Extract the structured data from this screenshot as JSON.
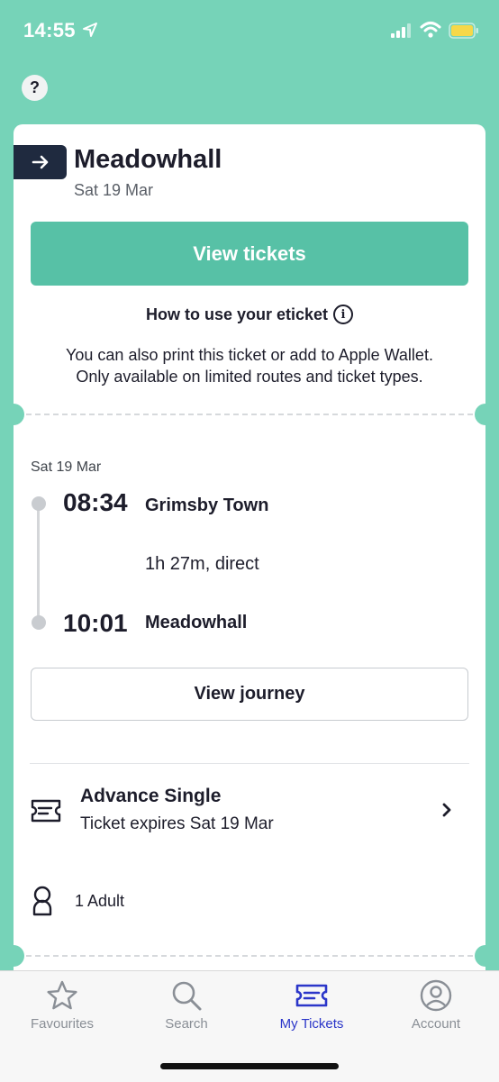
{
  "status_bar": {
    "time": "14:55"
  },
  "help_label": "?",
  "journey": {
    "destination": "Meadowhall",
    "date": "Sat 19 Mar",
    "view_tickets_label": "View tickets",
    "how_to_label": "How to use your eticket",
    "print_info_line1": "You can also print this ticket or add to Apple Wallet.",
    "print_info_line2": "Only available on limited routes and ticket types.",
    "leg_date": "Sat 19 Mar",
    "departure": {
      "time": "08:34",
      "station": "Grimsby Town"
    },
    "duration": "1h 27m, direct",
    "arrival": {
      "time": "10:01",
      "station": "Meadowhall"
    },
    "view_journey_label": "View journey"
  },
  "ticket": {
    "type": "Advance Single",
    "expiry": "Ticket expires Sat 19 Mar",
    "passengers": "1 Adult"
  },
  "tabs": [
    {
      "label": "Favourites",
      "icon": "star-icon",
      "active": false
    },
    {
      "label": "Search",
      "icon": "search-icon",
      "active": false
    },
    {
      "label": "My Tickets",
      "icon": "ticket-icon",
      "active": true
    },
    {
      "label": "Account",
      "icon": "account-icon",
      "active": false
    }
  ],
  "colors": {
    "background": "#76d3b8",
    "primary_button": "#57c1a6",
    "direction_badge": "#1f2a3f",
    "active_tab": "#2b36c9",
    "inactive_tab": "#8a8f96"
  }
}
